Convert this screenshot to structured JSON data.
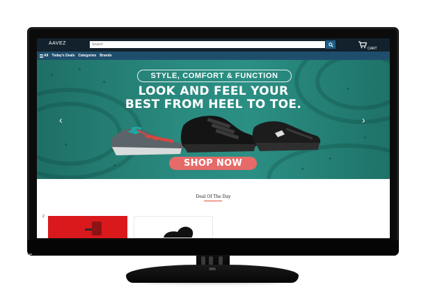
{
  "header": {
    "brand": "AAVEZ",
    "search_placeholder": "Search",
    "cart_label": "CART",
    "search_icon": "search-icon",
    "cart_icon": "cart-icon"
  },
  "nav": {
    "items": [
      "All",
      "Today's Deals",
      "Categories",
      "Brands"
    ],
    "menu_icon": "menu-icon"
  },
  "hero": {
    "tagline": "STYLE, COMFORT & FUNCTION",
    "headline_line1": "LOOK AND FEEL YOUR",
    "headline_line2": "BEST FROM HEEL TO TOE.",
    "cta_label": "SHOP NOW",
    "prev_icon": "chevron-left-icon",
    "next_icon": "chevron-right-icon"
  },
  "deals": {
    "section_title": "Deal Of The Day",
    "index_label": "2"
  },
  "colors": {
    "topbar": "#13212c",
    "navbar": "#1f4e6d",
    "hero_teal": "#2a8a7f",
    "cta": "#e66a68",
    "accent_underline": "#e74c3c",
    "card_red": "#d9191c"
  }
}
